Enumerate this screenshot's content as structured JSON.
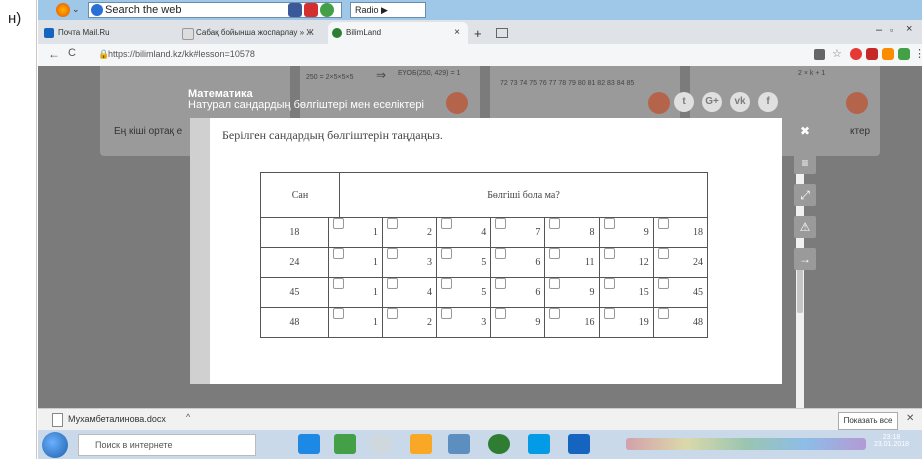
{
  "outer_label": "н)",
  "browser": {
    "search_placeholder": "Search the web",
    "radio_label": "Radio ▶",
    "tabs": [
      {
        "label": "Почта Mail.Ru"
      },
      {
        "label": "Сабақ бойынша жоспарлау » Ж"
      },
      {
        "label": "BilimLand"
      }
    ],
    "url": "https://bilimland.kz/kk#lesson=10578"
  },
  "page": {
    "subject": "Математика",
    "topic": "Натурал сандардың бөлгіштері мен еселіктері",
    "bg_card_left_text": "Ең кіші ортақ е",
    "bg_card_right_text": "ктер",
    "bg_formula_1": "250 = 2×5×5×5",
    "bg_formula_2": "ЕҮОБ(250, 429) = 1",
    "bg_numbers": "72 73 74 75 76 77 78 79 80 81 82 83 84 85",
    "bg_formula_3": "2 × k + 1"
  },
  "modal": {
    "instruction": "Берілген сандардың бөлгіштерін таңдаңыз.",
    "header_number": "Сан",
    "header_divisor": "Бөлгіші бола ма?",
    "rows": [
      {
        "number": "18",
        "options": [
          "1",
          "2",
          "4",
          "7",
          "8",
          "9",
          "18"
        ]
      },
      {
        "number": "24",
        "options": [
          "1",
          "3",
          "5",
          "6",
          "11",
          "12",
          "24"
        ]
      },
      {
        "number": "45",
        "options": [
          "1",
          "4",
          "5",
          "6",
          "9",
          "15",
          "45"
        ]
      },
      {
        "number": "48",
        "options": [
          "1",
          "2",
          "3",
          "9",
          "16",
          "19",
          "48"
        ]
      }
    ]
  },
  "downloads": {
    "filename": "Мухамбеталинова.docx",
    "show_all": "Показать все"
  },
  "taskbar": {
    "search_placeholder": "Поиск в интернете",
    "time": "23:18",
    "date": "23.01.2018"
  }
}
